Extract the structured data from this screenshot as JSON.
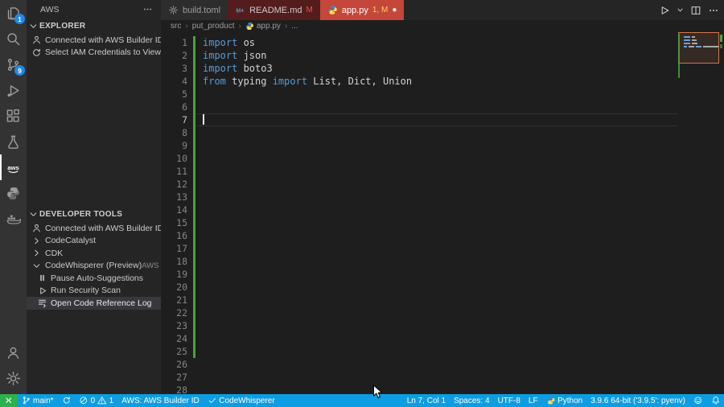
{
  "colors": {
    "keyword": "#569cd6",
    "plain_code": "#d4d4d4",
    "diff_added_green": "#49a33c",
    "badge_blue": "#2188e8",
    "status_bar_blue": "#0d9de2",
    "selected_row_bg": "#37373d",
    "tab_readme_bg": "#541c1c",
    "tab_apppy_bg": "#c4473a"
  },
  "activity_bar": {
    "items": [
      {
        "name": "explorer-icon",
        "icon": "files",
        "badge": "1"
      },
      {
        "name": "search-icon",
        "icon": "search"
      },
      {
        "name": "source-control-icon",
        "icon": "scm",
        "badge": "9"
      },
      {
        "name": "run-debug-icon",
        "icon": "debug"
      },
      {
        "name": "extensions-icon",
        "icon": "extensions"
      },
      {
        "name": "testing-icon",
        "icon": "beaker"
      },
      {
        "name": "aws-toolkit-icon",
        "icon": "aws",
        "active": true
      },
      {
        "name": "python-extension-icon",
        "icon": "python-gray"
      },
      {
        "name": "docker-icon",
        "icon": "docker"
      }
    ],
    "bottom_items": [
      {
        "name": "account-icon",
        "icon": "account"
      },
      {
        "name": "settings-gear-icon",
        "icon": "gear"
      }
    ]
  },
  "sidebar": {
    "title": "AWS",
    "explorer_section": {
      "label": "EXPLORER",
      "items": [
        {
          "name": "explorer-builder-id-status",
          "icon": "person",
          "label": "Connected with AWS Builder ID"
        },
        {
          "name": "select-iam-credentials",
          "icon": "refresh",
          "label": "Select IAM Credentials to View ..."
        }
      ]
    },
    "devtools_section": {
      "label": "DEVELOPER TOOLS",
      "items": [
        {
          "name": "devtools-builder-id-status",
          "icon": "person",
          "label": "Connected with AWS Builder ID"
        },
        {
          "name": "codecatalyst-item",
          "icon": "chevron-right",
          "label": "CodeCatalyst"
        },
        {
          "name": "cdk-item",
          "icon": "chevron-right",
          "label": "CDK"
        },
        {
          "name": "codewhisperer-item",
          "icon": "chevron-down",
          "label": "CodeWhisperer (Preview)",
          "meta": "AWS ..."
        },
        {
          "name": "pause-auto-suggestions-item",
          "icon": "pause",
          "label": "Pause Auto-Suggestions",
          "indent": 1
        },
        {
          "name": "run-security-scan-item",
          "icon": "play",
          "label": "Run Security Scan",
          "indent": 1
        },
        {
          "name": "open-code-reference-log-item",
          "icon": "reference-log",
          "label": "Open Code Reference Log",
          "indent": 1,
          "selected": true
        }
      ]
    }
  },
  "editor_tabs": [
    {
      "name": "tab-build-toml",
      "icon": "toml",
      "label": "build.toml",
      "bg": "#2d2d2d",
      "color": "#9d9d9d"
    },
    {
      "name": "tab-readme-md",
      "icon": "markdown",
      "label": "README.md",
      "badge": "M",
      "badge_color": "#f14c4c",
      "bg": "#541c1c",
      "color": "#cccccc"
    },
    {
      "name": "tab-app-py",
      "icon": "python",
      "label": "app.py",
      "badge": "1, M",
      "badge_color": "#ffd34d",
      "dirty": "●",
      "bg": "#c4473a",
      "color": "#ffffff",
      "active": true
    }
  ],
  "editor_actions": [
    {
      "name": "run-python-file-button",
      "icon": "run"
    },
    {
      "name": "run-dropdown-caret",
      "icon": "caret-down",
      "narrow": true
    },
    {
      "name": "split-editor-button",
      "icon": "split"
    },
    {
      "name": "more-editor-actions-button",
      "icon": "more"
    }
  ],
  "breadcrumb": {
    "items": [
      {
        "label": "src"
      },
      {
        "label": "put_product"
      },
      {
        "label": "app.py",
        "icon": "python"
      },
      {
        "label": "..."
      }
    ]
  },
  "editor": {
    "total_lines": 28,
    "current_line": 7,
    "cursor": {
      "line": 7,
      "col": 1,
      "label": "Ln 7, Col 1"
    },
    "diff_added_from": 1,
    "diff_added_to": 25,
    "lines": {
      "1": [
        [
          "kw",
          "import"
        ],
        [
          "pl",
          " os"
        ]
      ],
      "2": [
        [
          "kw",
          "import"
        ],
        [
          "pl",
          " json"
        ]
      ],
      "3": [
        [
          "kw",
          "import"
        ],
        [
          "pl",
          " boto3"
        ]
      ],
      "4": [
        [
          "kw",
          "from"
        ],
        [
          "pl",
          " typing "
        ],
        [
          "kw",
          "import"
        ],
        [
          "pl",
          " List, Dict, Union"
        ]
      ]
    }
  },
  "status_bar": {
    "left": [
      {
        "name": "remote-indicator",
        "bg": "#2bb24a",
        "parts": [
          {
            "icon": "remote"
          }
        ]
      },
      {
        "name": "git-branch-status",
        "parts": [
          {
            "icon": "branch"
          },
          {
            "text": "main*"
          }
        ]
      },
      {
        "name": "sync-changes-button",
        "parts": [
          {
            "icon": "sync"
          }
        ]
      },
      {
        "name": "problems-status",
        "parts": [
          {
            "icon": "error"
          },
          {
            "text": "0"
          },
          {
            "icon": "warning"
          },
          {
            "text": "1"
          }
        ]
      },
      {
        "name": "aws-credentials-status",
        "parts": [
          {
            "text": "AWS: AWS Builder ID"
          }
        ]
      },
      {
        "name": "codewhisperer-status",
        "parts": [
          {
            "icon": "check"
          },
          {
            "text": "CodeWhisperer"
          }
        ]
      }
    ],
    "right": [
      {
        "name": "cursor-position-status",
        "parts": [
          {
            "text": "Ln 7, Col 1"
          }
        ]
      },
      {
        "name": "indentation-status",
        "parts": [
          {
            "text": "Spaces: 4"
          }
        ]
      },
      {
        "name": "encoding-status",
        "parts": [
          {
            "text": "UTF-8"
          }
        ]
      },
      {
        "name": "eol-status",
        "parts": [
          {
            "text": "LF"
          }
        ]
      },
      {
        "name": "language-mode-status",
        "parts": [
          {
            "icon": "python"
          },
          {
            "text": "Python"
          }
        ]
      },
      {
        "name": "python-interpreter-status",
        "parts": [
          {
            "text": "3.9.6 64-bit ('3.9.5': pyenv)"
          }
        ]
      },
      {
        "name": "feedback-button",
        "parts": [
          {
            "icon": "feedback"
          }
        ]
      },
      {
        "name": "notifications-bell",
        "parts": [
          {
            "icon": "bell"
          }
        ]
      }
    ]
  }
}
